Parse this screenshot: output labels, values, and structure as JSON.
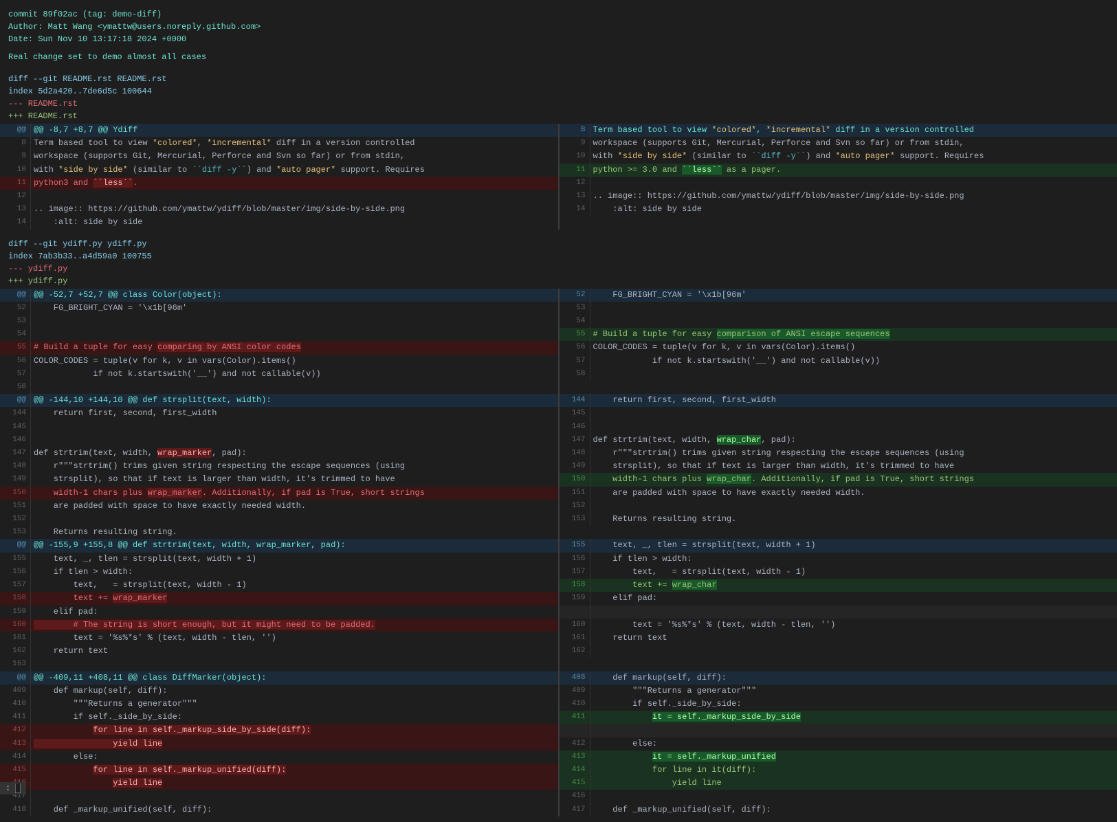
{
  "header": {
    "commit": "commit 89f02ac (tag: demo-diff)",
    "author": "Author: Matt Wang <ymattw@users.noreply.github.com>",
    "date": "Date:   Sun Nov 10 13:17:18 2024 +0000",
    "message": "    Real change set to demo almost all cases"
  },
  "colors": {
    "bg": "#1e1e1e",
    "teal": "#6de3d0",
    "green": "#98c379",
    "red": "#e06c75",
    "blue": "#61afef",
    "yellow": "#e5c07b",
    "orange": "#d19a66"
  }
}
